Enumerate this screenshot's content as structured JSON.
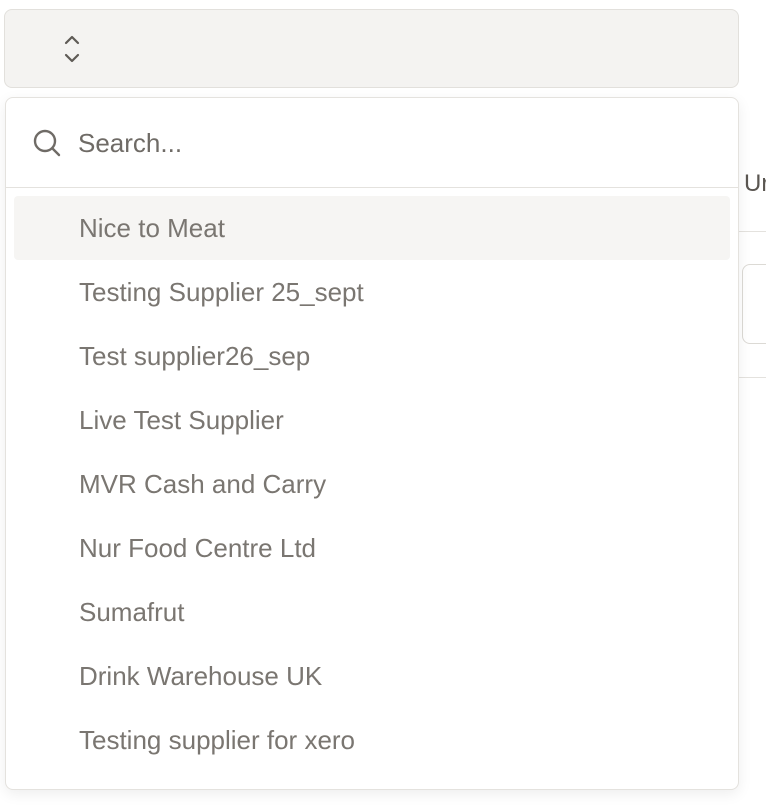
{
  "select": {
    "value": "",
    "icon": "chevron-up-down-icon"
  },
  "dropdown": {
    "search": {
      "placeholder": "Search...",
      "value": "",
      "icon": "search-icon"
    },
    "highlighted_index": 0,
    "options": [
      {
        "label": "Nice to Meat"
      },
      {
        "label": "Testing Supplier 25_sept"
      },
      {
        "label": "Test supplier26_sep"
      },
      {
        "label": "Live Test Supplier"
      },
      {
        "label": "MVR Cash and Carry"
      },
      {
        "label": "Nur Food Centre Ltd"
      },
      {
        "label": "Sumafrut"
      },
      {
        "label": "Drink Warehouse UK"
      },
      {
        "label": "Testing supplier for xero"
      }
    ]
  },
  "background": {
    "column_label": "Ur"
  },
  "colors": {
    "trigger_bg": "#f4f3f1",
    "highlight_bg": "#f6f5f3",
    "border": "#e4e2de",
    "option_text": "#7a7671"
  }
}
